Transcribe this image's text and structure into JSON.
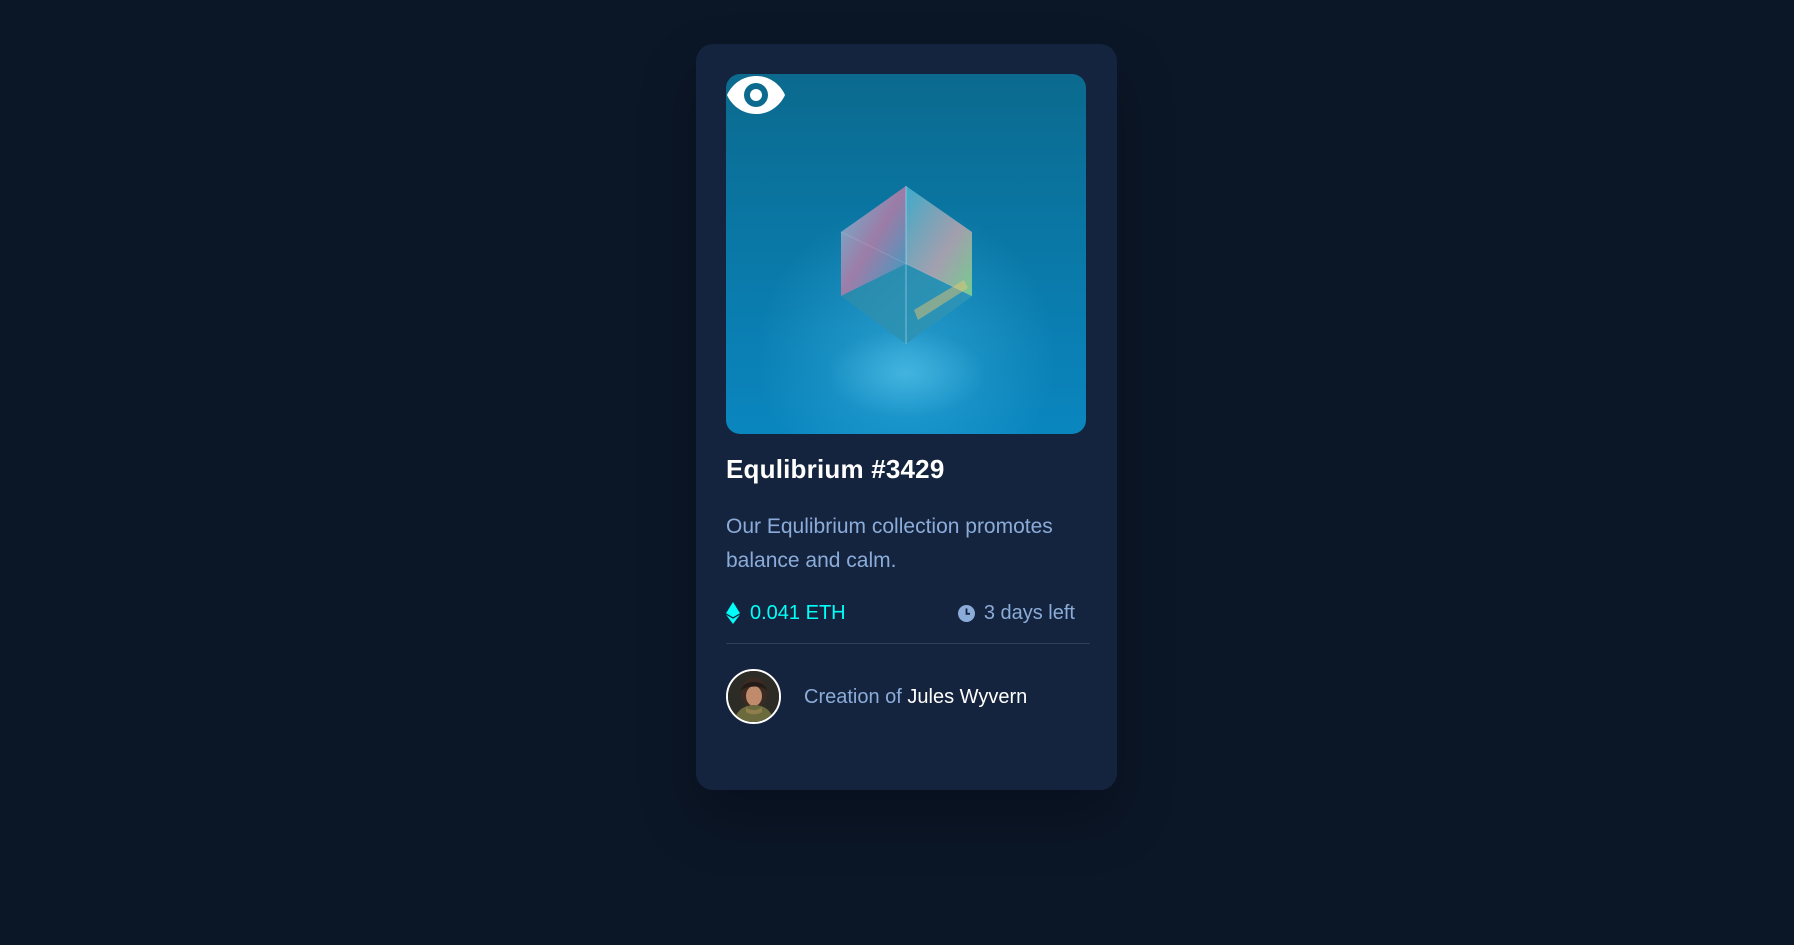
{
  "card": {
    "image": {
      "alt": "Equilibrium cube",
      "overlay_icon": "eye-icon"
    },
    "title": "Equlibrium #3429",
    "description": "Our Equlibrium collection promotes balance and calm.",
    "price": {
      "icon": "ethereum-icon",
      "value": "0.041 ETH"
    },
    "time_left": {
      "icon": "clock-icon",
      "value": "3 days left"
    },
    "creator": {
      "prefix": "Creation of ",
      "name": "Jules Wyvern"
    }
  },
  "colors": {
    "page_background": "#0b1627",
    "card_background": "#15243e",
    "accent_cyan": "#00fff8",
    "soft_blue": "#8bacd9",
    "white": "#ffffff",
    "divider": "#2e405a"
  }
}
